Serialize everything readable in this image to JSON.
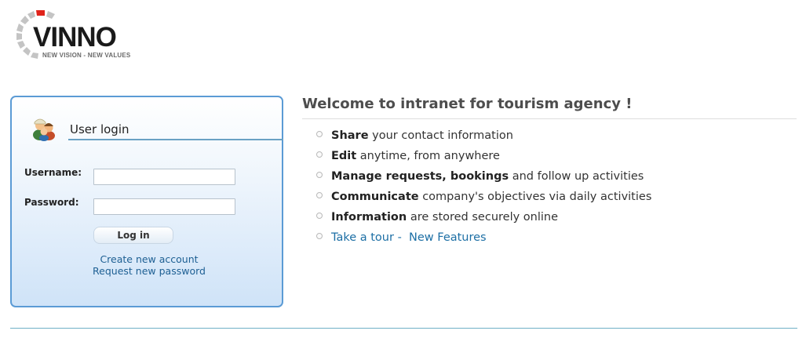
{
  "brand": {
    "name": "VINNO",
    "tagline": "NEW VISION - NEW VALUES",
    "colors": {
      "accent": "#e0231a",
      "segments": "#c8c8c8"
    }
  },
  "login": {
    "title": "User login",
    "username_label": "Username:",
    "password_label": "Password:",
    "username_value": "",
    "password_value": "",
    "submit_label": "Log in",
    "create_account": "Create new account",
    "request_password": "Request new password",
    "icon": "users-icon"
  },
  "welcome": {
    "title": "Welcome to intranet for tourism agency !",
    "items": [
      {
        "bold": "Share",
        "rest": " your contact information"
      },
      {
        "bold": "Edit",
        "rest": " anytime, from anywhere"
      },
      {
        "bold": "Manage requests, bookings",
        "rest": " and follow up activities"
      },
      {
        "bold": "Communicate",
        "rest": " company's objectives via daily activities"
      },
      {
        "bold": "Information",
        "rest": " are stored securely online"
      }
    ],
    "tour": {
      "link1": "Take a tour",
      "separator": " -  ",
      "link2": "New Features"
    }
  }
}
